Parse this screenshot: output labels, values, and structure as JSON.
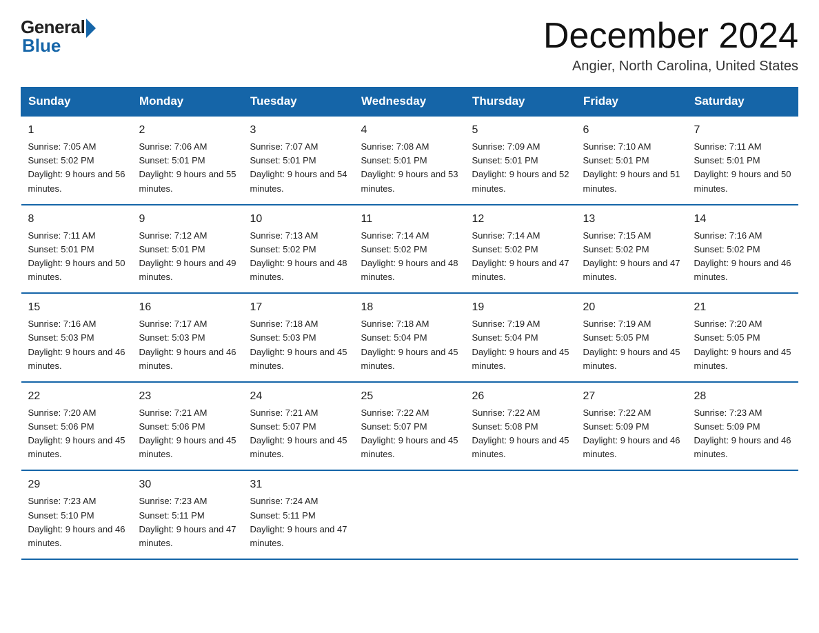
{
  "header": {
    "logo_general": "General",
    "logo_blue": "Blue",
    "month_title": "December 2024",
    "location": "Angier, North Carolina, United States"
  },
  "days_of_week": [
    "Sunday",
    "Monday",
    "Tuesday",
    "Wednesday",
    "Thursday",
    "Friday",
    "Saturday"
  ],
  "weeks": [
    [
      {
        "day": "1",
        "sunrise": "7:05 AM",
        "sunset": "5:02 PM",
        "daylight": "9 hours and 56 minutes."
      },
      {
        "day": "2",
        "sunrise": "7:06 AM",
        "sunset": "5:01 PM",
        "daylight": "9 hours and 55 minutes."
      },
      {
        "day": "3",
        "sunrise": "7:07 AM",
        "sunset": "5:01 PM",
        "daylight": "9 hours and 54 minutes."
      },
      {
        "day": "4",
        "sunrise": "7:08 AM",
        "sunset": "5:01 PM",
        "daylight": "9 hours and 53 minutes."
      },
      {
        "day": "5",
        "sunrise": "7:09 AM",
        "sunset": "5:01 PM",
        "daylight": "9 hours and 52 minutes."
      },
      {
        "day": "6",
        "sunrise": "7:10 AM",
        "sunset": "5:01 PM",
        "daylight": "9 hours and 51 minutes."
      },
      {
        "day": "7",
        "sunrise": "7:11 AM",
        "sunset": "5:01 PM",
        "daylight": "9 hours and 50 minutes."
      }
    ],
    [
      {
        "day": "8",
        "sunrise": "7:11 AM",
        "sunset": "5:01 PM",
        "daylight": "9 hours and 50 minutes."
      },
      {
        "day": "9",
        "sunrise": "7:12 AM",
        "sunset": "5:01 PM",
        "daylight": "9 hours and 49 minutes."
      },
      {
        "day": "10",
        "sunrise": "7:13 AM",
        "sunset": "5:02 PM",
        "daylight": "9 hours and 48 minutes."
      },
      {
        "day": "11",
        "sunrise": "7:14 AM",
        "sunset": "5:02 PM",
        "daylight": "9 hours and 48 minutes."
      },
      {
        "day": "12",
        "sunrise": "7:14 AM",
        "sunset": "5:02 PM",
        "daylight": "9 hours and 47 minutes."
      },
      {
        "day": "13",
        "sunrise": "7:15 AM",
        "sunset": "5:02 PM",
        "daylight": "9 hours and 47 minutes."
      },
      {
        "day": "14",
        "sunrise": "7:16 AM",
        "sunset": "5:02 PM",
        "daylight": "9 hours and 46 minutes."
      }
    ],
    [
      {
        "day": "15",
        "sunrise": "7:16 AM",
        "sunset": "5:03 PM",
        "daylight": "9 hours and 46 minutes."
      },
      {
        "day": "16",
        "sunrise": "7:17 AM",
        "sunset": "5:03 PM",
        "daylight": "9 hours and 46 minutes."
      },
      {
        "day": "17",
        "sunrise": "7:18 AM",
        "sunset": "5:03 PM",
        "daylight": "9 hours and 45 minutes."
      },
      {
        "day": "18",
        "sunrise": "7:18 AM",
        "sunset": "5:04 PM",
        "daylight": "9 hours and 45 minutes."
      },
      {
        "day": "19",
        "sunrise": "7:19 AM",
        "sunset": "5:04 PM",
        "daylight": "9 hours and 45 minutes."
      },
      {
        "day": "20",
        "sunrise": "7:19 AM",
        "sunset": "5:05 PM",
        "daylight": "9 hours and 45 minutes."
      },
      {
        "day": "21",
        "sunrise": "7:20 AM",
        "sunset": "5:05 PM",
        "daylight": "9 hours and 45 minutes."
      }
    ],
    [
      {
        "day": "22",
        "sunrise": "7:20 AM",
        "sunset": "5:06 PM",
        "daylight": "9 hours and 45 minutes."
      },
      {
        "day": "23",
        "sunrise": "7:21 AM",
        "sunset": "5:06 PM",
        "daylight": "9 hours and 45 minutes."
      },
      {
        "day": "24",
        "sunrise": "7:21 AM",
        "sunset": "5:07 PM",
        "daylight": "9 hours and 45 minutes."
      },
      {
        "day": "25",
        "sunrise": "7:22 AM",
        "sunset": "5:07 PM",
        "daylight": "9 hours and 45 minutes."
      },
      {
        "day": "26",
        "sunrise": "7:22 AM",
        "sunset": "5:08 PM",
        "daylight": "9 hours and 45 minutes."
      },
      {
        "day": "27",
        "sunrise": "7:22 AM",
        "sunset": "5:09 PM",
        "daylight": "9 hours and 46 minutes."
      },
      {
        "day": "28",
        "sunrise": "7:23 AM",
        "sunset": "5:09 PM",
        "daylight": "9 hours and 46 minutes."
      }
    ],
    [
      {
        "day": "29",
        "sunrise": "7:23 AM",
        "sunset": "5:10 PM",
        "daylight": "9 hours and 46 minutes."
      },
      {
        "day": "30",
        "sunrise": "7:23 AM",
        "sunset": "5:11 PM",
        "daylight": "9 hours and 47 minutes."
      },
      {
        "day": "31",
        "sunrise": "7:24 AM",
        "sunset": "5:11 PM",
        "daylight": "9 hours and 47 minutes."
      },
      null,
      null,
      null,
      null
    ]
  ]
}
